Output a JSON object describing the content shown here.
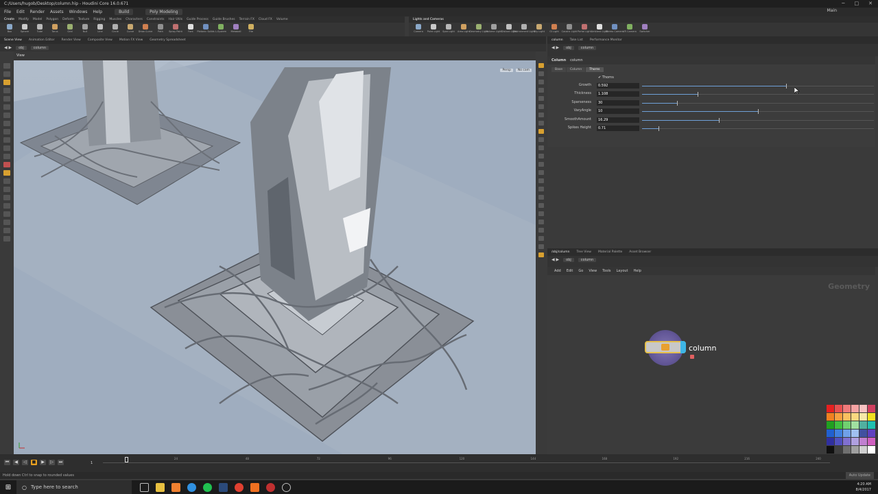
{
  "window": {
    "title": "C:/Users/hugob/Desktop/column.hip - Houdini Core 16.0.671",
    "controls": [
      "─",
      "□",
      "✕"
    ]
  },
  "menubar": {
    "items": [
      "File",
      "Edit",
      "Render",
      "Assets",
      "Windows",
      "Help"
    ],
    "desktop_left": "Build",
    "desktop_right": "Poly Modeling",
    "right": "Main"
  },
  "shelf_left": {
    "tabs": [
      "Create",
      "Modify",
      "Model",
      "Polygon",
      "Deform",
      "Texture",
      "Rigging",
      "Muscles",
      "Characters",
      "Constraints",
      "Hair Utils",
      "Guide Process",
      "Guide Brushes",
      "Terrain FX",
      "Cloud FX",
      "Volume"
    ],
    "tools": [
      "Box",
      "Sphere",
      "Tube",
      "Torus",
      "Grid",
      "Null",
      "Line",
      "Circle",
      "Curve",
      "Draw Curve",
      "Path",
      "Spray Paint",
      "Font",
      "Platonic Solids",
      "L-System",
      "Metaball",
      "File"
    ]
  },
  "shelf_right": {
    "tabs": [
      "Lights and Cameras"
    ],
    "tools": [
      "Camera",
      "Point Light",
      "Spot Light",
      "Area Light",
      "Geometry Light",
      "Volume Light",
      "Distant Light",
      "Environment Light",
      "Sky Light",
      "GI Light",
      "Caustic Light",
      "Portal Light",
      "Ambient Light",
      "Stereo Camera",
      "VR Camera",
      "Switcher"
    ]
  },
  "left_pane": {
    "tabs": [
      "Scene View",
      "Animation Editor",
      "Render View",
      "Composite View",
      "Motion FX View",
      "Geometry Spreadsheet"
    ],
    "path": [
      "obj",
      "column"
    ],
    "view_label": "View",
    "cam": [
      "Persp",
      "No cam"
    ]
  },
  "param_pane": {
    "tabs": [
      "column",
      "Take List",
      "Performance Monitor"
    ],
    "path": [
      "obj",
      "column"
    ],
    "node_type": "Column",
    "node_name": "column",
    "param_tabs": [
      "Base",
      "Column",
      "Thorns"
    ],
    "active_tab": "Thorns",
    "folder": "Thorns",
    "params": [
      {
        "label": "Growth",
        "value": "0.592",
        "fill": 0.62,
        "knob": 0.62
      },
      {
        "label": "Thickness",
        "value": "1.108",
        "fill": 0.24,
        "knob": 0.24
      },
      {
        "label": "Sparseness",
        "value": "30",
        "fill": 0.15,
        "knob": 0.15
      },
      {
        "label": "VaryAngle",
        "value": "10",
        "fill": 0.5,
        "knob": 0.5
      },
      {
        "label": "SmoothAmount",
        "value": "16.29",
        "fill": 0.33,
        "knob": 0.33
      },
      {
        "label": "Spikes Height",
        "value": "0.71",
        "fill": 0.07,
        "knob": 0.07
      }
    ]
  },
  "node_pane": {
    "tabs": [
      "/obj/column",
      "Tree View",
      "Material Palette",
      "Asset Browser"
    ],
    "path": [
      "obj",
      "column"
    ],
    "menu": [
      "Add",
      "Edit",
      "Go",
      "View",
      "Tools",
      "Layout",
      "Help"
    ],
    "context_label": "Geometry",
    "node_label": "column"
  },
  "timeline": {
    "frame": "1",
    "start": "1",
    "ticks": [
      "24",
      "48",
      "72",
      "96",
      "120",
      "144",
      "168",
      "192",
      "216",
      "240"
    ],
    "end": "240"
  },
  "status": {
    "message": "Hold down Ctrl to snap to rounded values",
    "auto_update": "Auto Update"
  },
  "taskbar": {
    "search_placeholder": "Type here to search",
    "time": "4:20 AM",
    "date": "8/4/2017"
  },
  "palette_colors": [
    "#e62020",
    "#e85050",
    "#f07a7a",
    "#f5a3a3",
    "#f7c2c2",
    "#d04060",
    "#f08020",
    "#f7a040",
    "#f9c060",
    "#fad880",
    "#f5e8a8",
    "#f0e020",
    "#20a020",
    "#40c040",
    "#70d070",
    "#a0e0a0",
    "#50b0a0",
    "#20c0b0",
    "#2060d0",
    "#4080e0",
    "#70a0e8",
    "#a0c0f0",
    "#4050a0",
    "#6040c0",
    "#3030a0",
    "#5050c0",
    "#8070d0",
    "#b0a0e0",
    "#c080d0",
    "#d060c0",
    "#101010",
    "#404040",
    "#707070",
    "#a0a0a0",
    "#d0d0d0",
    "#ffffff"
  ]
}
